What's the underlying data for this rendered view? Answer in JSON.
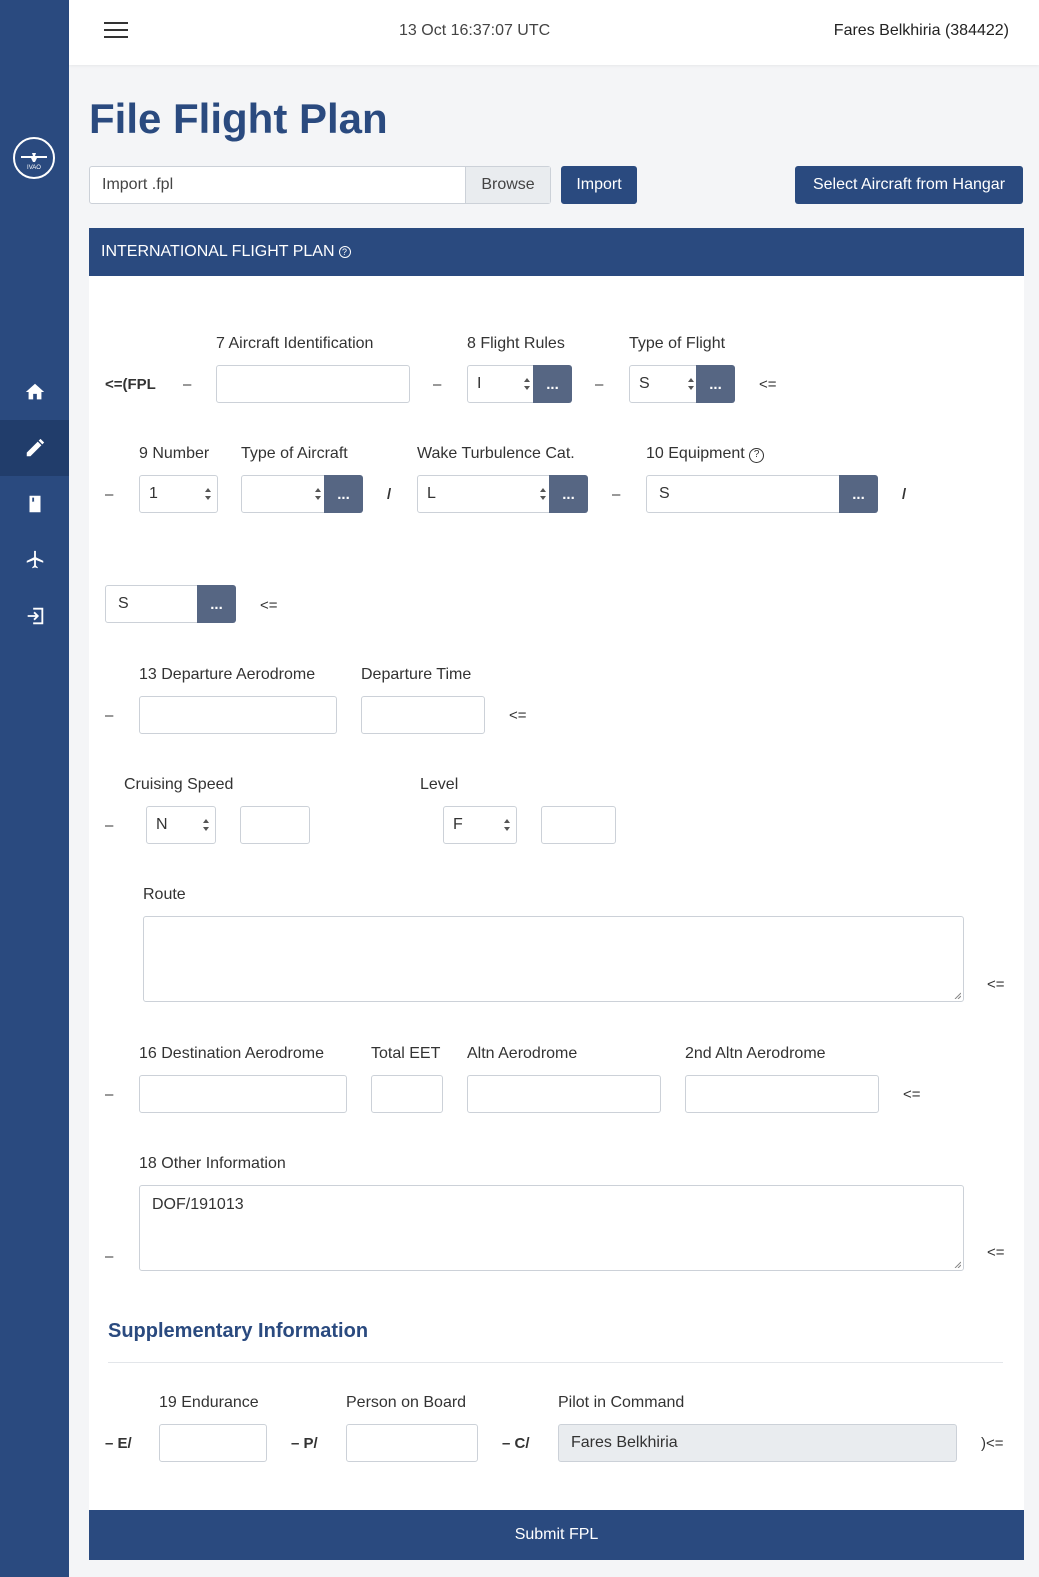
{
  "topbar": {
    "time": "13 Oct 16:37:07 UTC",
    "user": "Fares Belkhiria (384422)"
  },
  "sidebar": {
    "logo_text": "IVAO",
    "items": [
      "home-icon",
      "pencil-icon",
      "book-icon",
      "plane-icon",
      "sign-out-icon"
    ]
  },
  "page": {
    "title": "File Flight Plan"
  },
  "import": {
    "file_label": "Import .fpl",
    "browse": "Browse",
    "button": "Import"
  },
  "hangar_button": "Select Aircraft from Hangar",
  "card": {
    "header": "INTERNATIONAL FLIGHT PLAN",
    "help": "?"
  },
  "symbols": {
    "fpl_open": "<=(FPL",
    "dash": "–",
    "slash": "/",
    "end": "<=",
    "close": ")<=",
    "dots": "..."
  },
  "row7": {
    "aircraft_id_label": "7 Aircraft Identification",
    "aircraft_id_value": "",
    "flight_rules_label": "8 Flight Rules",
    "flight_rules_value": "I",
    "type_flight_label": "Type of Flight",
    "type_flight_value": "S"
  },
  "row9": {
    "number_label": "9 Number",
    "number_value": "1",
    "type_aircraft_label": "Type of Aircraft",
    "type_aircraft_value": "",
    "wake_label": "Wake Turbulence Cat.",
    "wake_value": "L",
    "equipment_label": "10 Equipment",
    "equipment_value": "S",
    "surveillance_value": "S"
  },
  "row13": {
    "departure_label": "13 Departure Aerodrome",
    "departure_value": "",
    "dep_time_label": "Departure Time",
    "dep_time_value": ""
  },
  "row15": {
    "speed_label": "Cruising Speed",
    "speed_unit": "N",
    "speed_value": "",
    "level_label": "Level",
    "level_unit": "F",
    "level_value": "",
    "route_label": "Route",
    "route_value": ""
  },
  "row16": {
    "dest_label": "16 Destination Aerodrome",
    "dest_value": "",
    "eet_label": "Total EET",
    "eet_value": "",
    "altn_label": "Altn Aerodrome",
    "altn_value": "",
    "altn2_label": "2nd Altn Aerodrome",
    "altn2_value": ""
  },
  "row18": {
    "other_label": "18 Other Information",
    "other_value": "DOF/191013"
  },
  "supplementary": {
    "title": "Supplementary Information",
    "endurance_prefix": "– E/",
    "endurance_label": "19 Endurance",
    "endurance_value": "",
    "pob_prefix": "– P/",
    "pob_label": "Person on Board",
    "pob_value": "",
    "pic_prefix": "– C/",
    "pic_label": "Pilot in Command",
    "pic_value": "Fares Belkhiria"
  },
  "submit": "Submit FPL"
}
